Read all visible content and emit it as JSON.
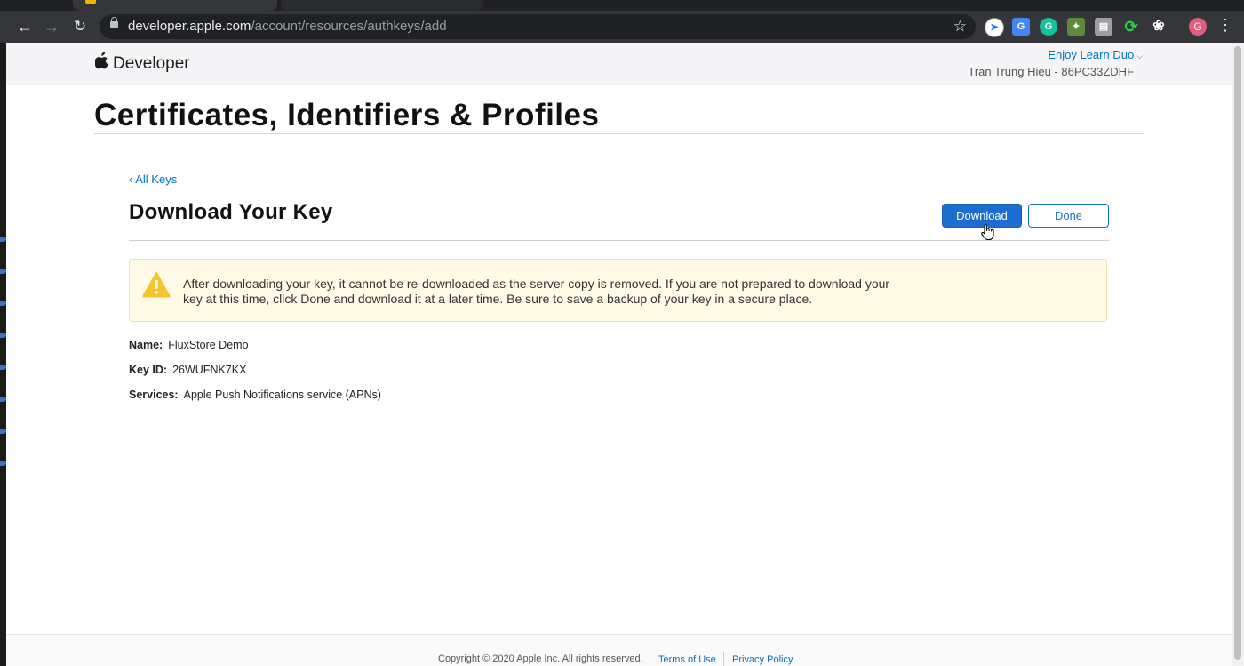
{
  "browser": {
    "url_host": "developer.apple.com",
    "url_path": "/account/resources/authkeys/add",
    "profile_initial": "G",
    "ext_grammarly": "G",
    "ext_translate": "G"
  },
  "header": {
    "brand": "Developer",
    "team_switcher": "Enjoy Learn Duo",
    "team_name": "Tran Trung Hieu - 86PC33ZDHF"
  },
  "page": {
    "title": "Certificates, Identifiers & Profiles",
    "back_link": "All Keys",
    "section_title": "Download Your Key",
    "download_label": "Download",
    "done_label": "Done"
  },
  "alert": {
    "text": "After downloading your key, it cannot be re-downloaded as the server copy is removed. If you are not prepared to download your key at this time, click Done and download it at a later time. Be sure to save a backup of your key in a secure place."
  },
  "details": {
    "name_label": "Name:",
    "name_value": "FluxStore Demo",
    "keyid_label": "Key ID:",
    "keyid_value": "26WUFNK7KX",
    "services_label": "Services:",
    "services_value": "Apple Push Notifications service (APNs)"
  },
  "footer": {
    "copyright": "Copyright © 2020 Apple Inc. All rights reserved.",
    "terms": "Terms of Use",
    "privacy": "Privacy Policy"
  },
  "colors": {
    "accent": "#1c6dd0",
    "link": "#0070c9",
    "alert_bg": "#fffbe6",
    "warning": "#f4c531"
  }
}
